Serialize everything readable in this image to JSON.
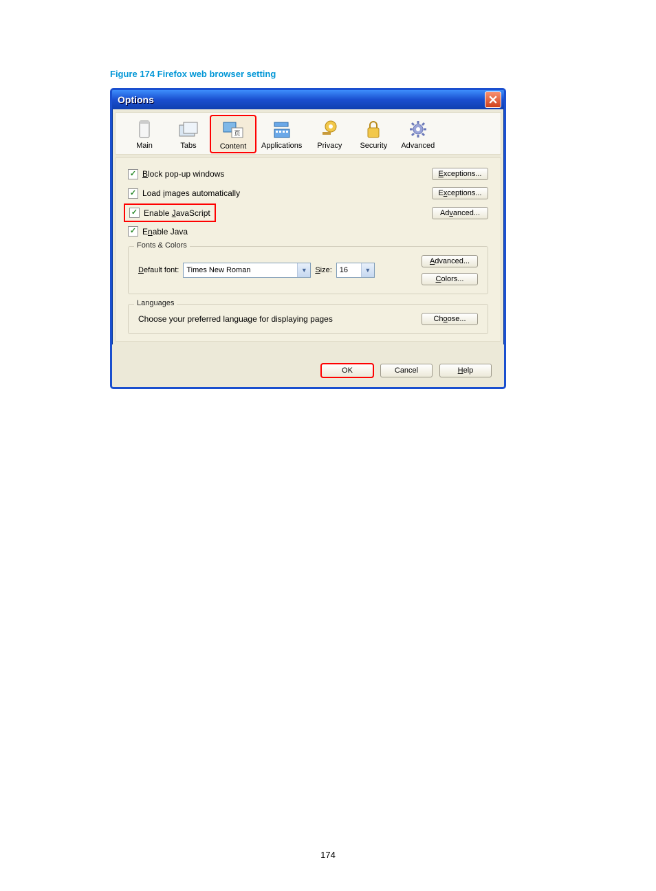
{
  "caption": "Figure 174 Firefox web browser setting",
  "window": {
    "title": "Options"
  },
  "toolbar": {
    "items": [
      {
        "label": "Main"
      },
      {
        "label": "Tabs"
      },
      {
        "label": "Content"
      },
      {
        "label": "Applications"
      },
      {
        "label": "Privacy"
      },
      {
        "label": "Security"
      },
      {
        "label": "Advanced"
      }
    ]
  },
  "content": {
    "check1": "Block pop-up windows",
    "check1_btn": "Exceptions...",
    "check2": "Load images automatically",
    "check2_btn": "Exceptions...",
    "check3": "Enable JavaScript",
    "check3_btn": "Advanced...",
    "check4": "Enable Java"
  },
  "fonts": {
    "legend": "Fonts & Colors",
    "default_font_label": "Default font:",
    "default_font_value": "Times New Roman",
    "size_label": "Size:",
    "size_value": "16",
    "advanced_btn": "Advanced...",
    "colors_btn": "Colors..."
  },
  "languages": {
    "legend": "Languages",
    "text": "Choose your preferred language for displaying pages",
    "choose_btn": "Choose..."
  },
  "buttons": {
    "ok": "OK",
    "cancel": "Cancel",
    "help": "Help"
  },
  "page_number": "174"
}
